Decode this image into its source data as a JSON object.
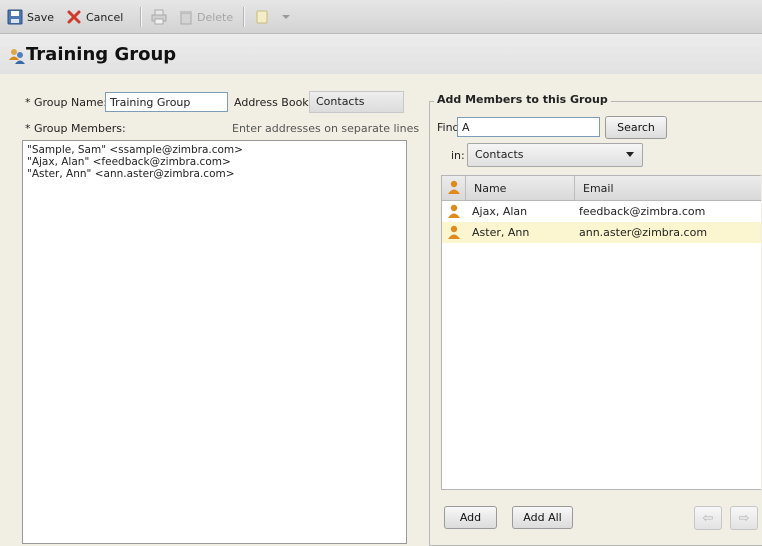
{
  "toolbar": {
    "save_label": "Save",
    "cancel_label": "Cancel",
    "delete_label": "Delete"
  },
  "page": {
    "title": "Training Group"
  },
  "form": {
    "group_name_label": "* Group Name:",
    "group_name_value": "Training Group",
    "address_book_label": "Address Book:",
    "address_book_value": "Contacts",
    "group_members_label": "* Group Members:",
    "members_hint": "Enter addresses on separate lines",
    "members_text": "\"Sample, Sam\" <ssample@zimbra.com>\n\"Ajax, Alan\" <feedback@zimbra.com>\n\"Aster, Ann\" <ann.aster@zimbra.com>"
  },
  "add_members": {
    "legend": "Add Members to this Group",
    "find_label": "Find:",
    "find_value": "A",
    "search_label": "Search",
    "in_label": "in:",
    "in_value": "Contacts",
    "columns": {
      "name": "Name",
      "email": "Email"
    },
    "results": [
      {
        "name": "Ajax, Alan",
        "email": "feedback@zimbra.com",
        "selected": false
      },
      {
        "name": "Aster, Ann",
        "email": "ann.aster@zimbra.com",
        "selected": true
      }
    ],
    "add_label": "Add",
    "add_all_label": "Add All"
  },
  "colors": {
    "background": "#f1eee3",
    "selected_row": "#fbf6cf",
    "contact_icon": "#e08a1e"
  }
}
